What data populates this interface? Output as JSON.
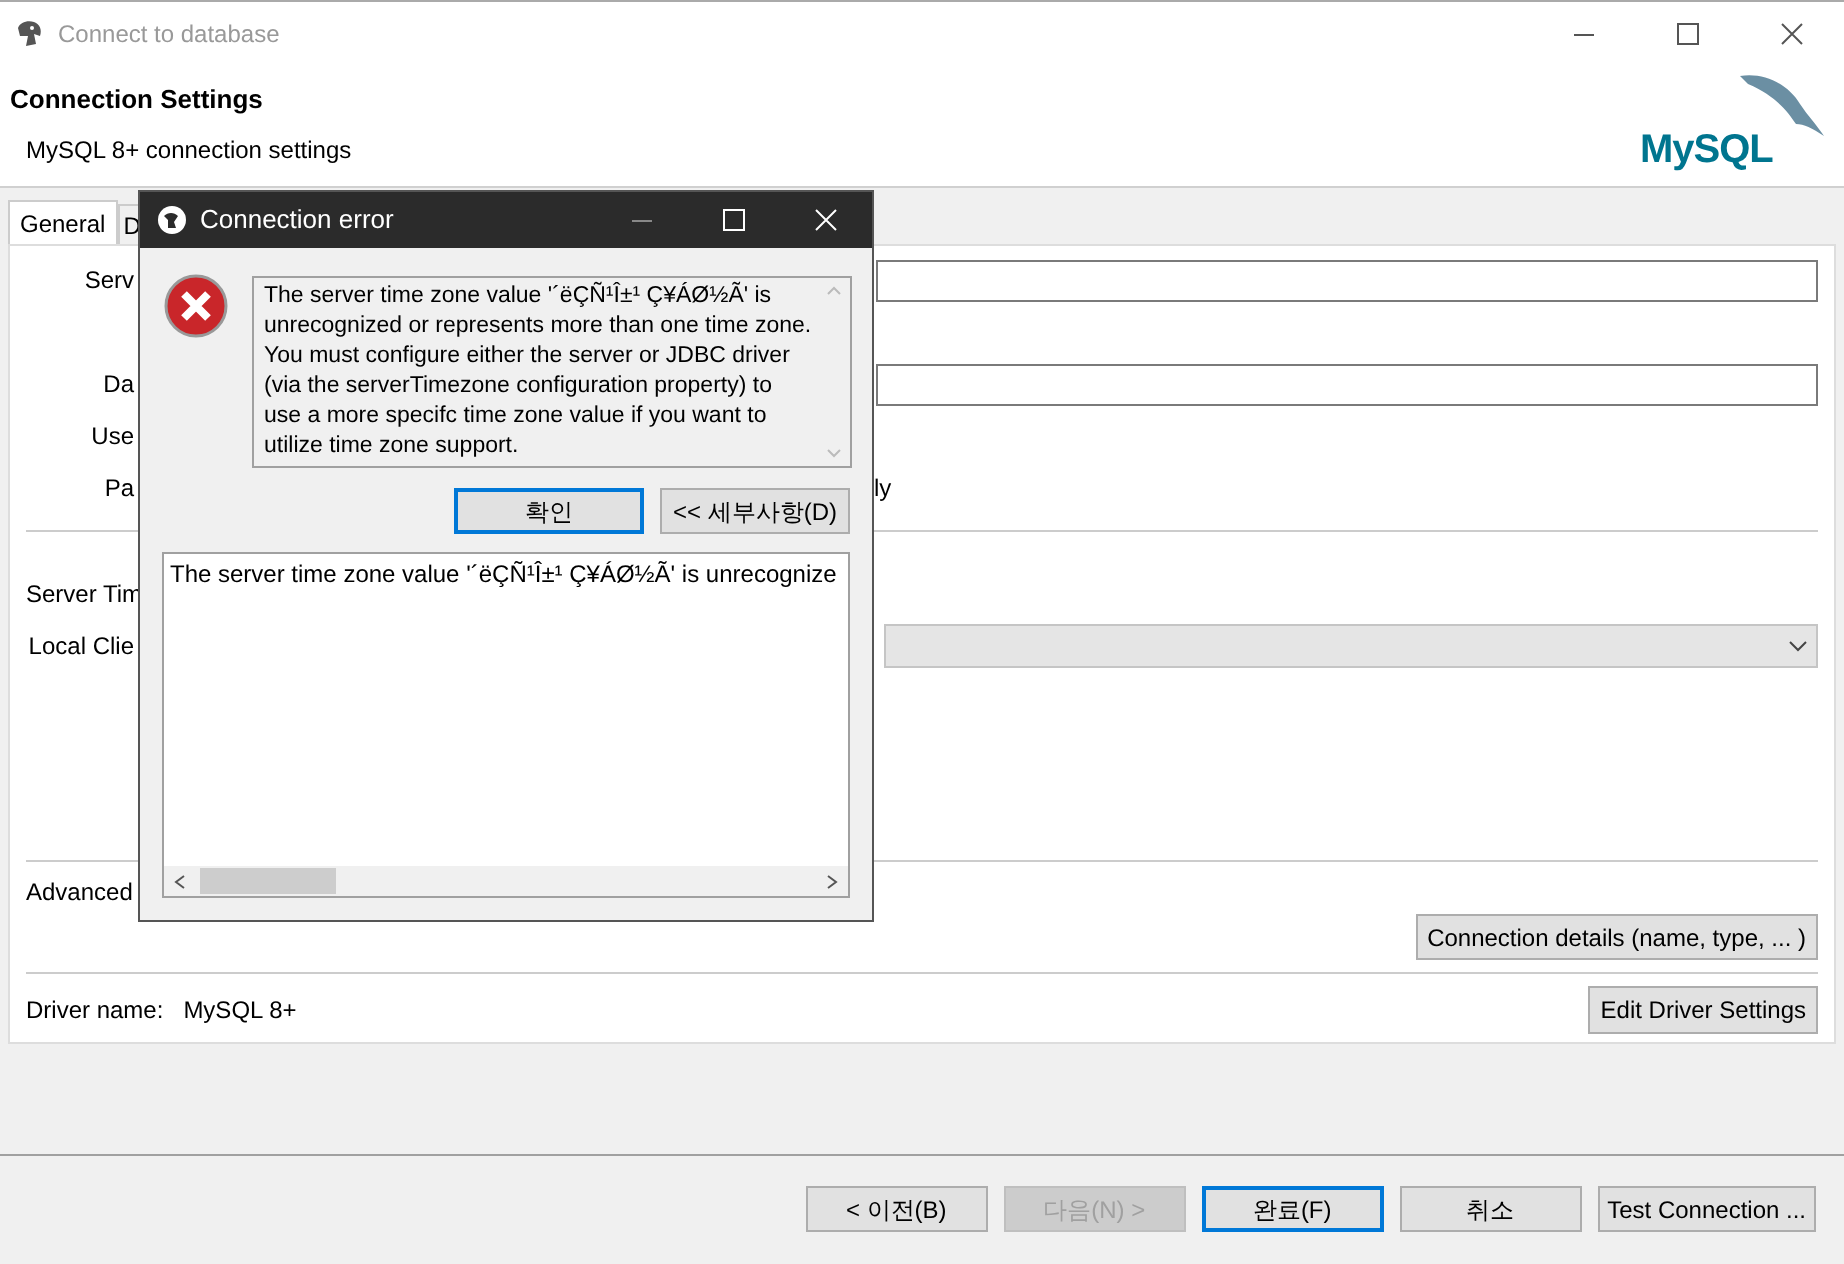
{
  "window": {
    "title": "Connect to database"
  },
  "header": {
    "title": "Connection Settings",
    "subtitle": "MySQL 8+ connection settings",
    "logo": "MySQL"
  },
  "tabs": [
    {
      "label": "General",
      "selected": true
    },
    {
      "label": "D",
      "selected": false
    }
  ],
  "form": {
    "labels": [
      "Serv",
      "Da",
      "Use",
      "Pa"
    ],
    "fields": [
      {
        "kind": "input"
      },
      {
        "kind": "input"
      }
    ],
    "trailing_text": "ly",
    "server_time_label": "Server Tim",
    "local_client_label": "Local Clie",
    "advanced_label": "Advanced",
    "connection_details_button": "Connection details (name, type, ... )",
    "driver_label": "Driver name:",
    "driver_value": "MySQL 8+",
    "edit_driver_button": "Edit Driver Settings"
  },
  "footer_buttons": [
    {
      "label": "< 이전(B)",
      "disabled": false,
      "default": false
    },
    {
      "label": "다음(N) >",
      "disabled": true,
      "default": false
    },
    {
      "label": "완료(F)",
      "disabled": false,
      "default": true
    },
    {
      "label": "취소",
      "disabled": false,
      "default": false
    },
    {
      "label": "Test Connection ...",
      "disabled": false,
      "default": false
    }
  ],
  "dialog": {
    "title": "Connection error",
    "message": "The server time zone value '´ëÇÑ¹Î±¹ Ç¥ÁØ½Ã' is unrecognized or represents more than one time zone. You must configure either the server or JDBC driver (via the serverTimezone configuration property) to use a more specifc time zone value if you want to utilize time zone support.",
    "buttons": [
      {
        "label": "확인",
        "default": true
      },
      {
        "label": "<< 세부사항(D)",
        "default": false
      }
    ],
    "details": "The server time zone value '´ëÇÑ¹Î±¹ Ç¥ÁØ½Ã' is unrecognize"
  }
}
